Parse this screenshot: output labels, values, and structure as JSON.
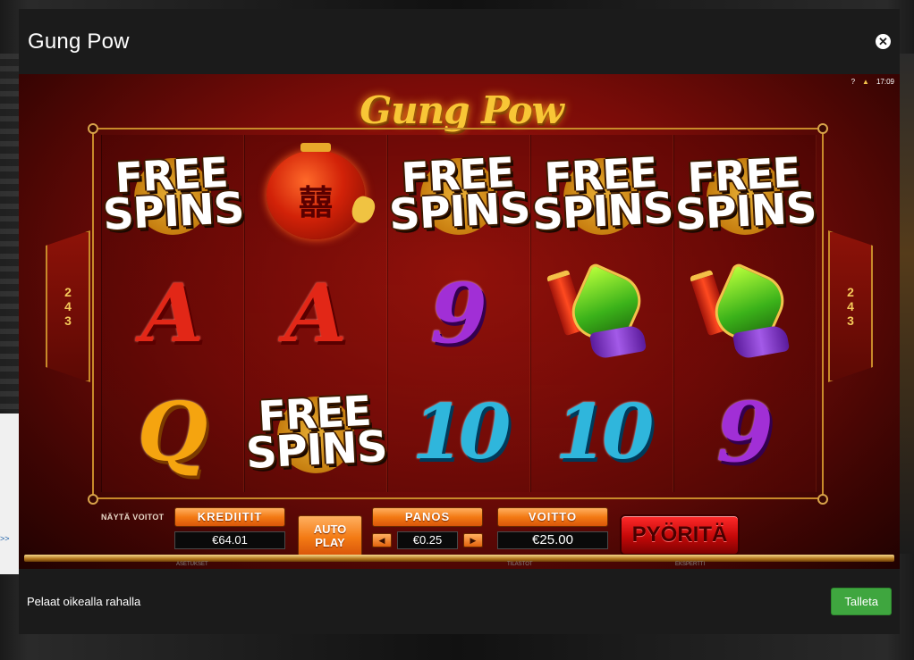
{
  "modal": {
    "title": "Gung Pow",
    "close_icon": "close-icon"
  },
  "game": {
    "logo": "Gung Pow",
    "clock": {
      "help": "?",
      "time": "17:09"
    },
    "ways_left": [
      "2",
      "4",
      "3"
    ],
    "ways_right": [
      "2",
      "4",
      "3"
    ],
    "reels": [
      [
        "free-spins",
        "letter-a",
        "letter-q"
      ],
      [
        "lantern",
        "letter-a",
        "free-spins"
      ],
      [
        "free-spins",
        "number-9",
        "number-10"
      ],
      [
        "free-spins",
        "rocket",
        "number-10"
      ],
      [
        "free-spins",
        "rocket",
        "number-9"
      ]
    ],
    "symbol_text": {
      "free_line1": "FREE",
      "free_line2": "SPINS",
      "a": "A",
      "q": "Q",
      "nine": "9",
      "ten": "10",
      "lantern_glyph": "囍"
    }
  },
  "controls": {
    "show_wins": "NÄYTÄ VOITOT",
    "credits_label": "KREDIITIT",
    "credits_value": "€64.01",
    "autoplay_line1": "AUTO",
    "autoplay_line2": "PLAY",
    "bet_label": "PANOS",
    "bet_value": "€0.25",
    "bet_decrease": "◀",
    "bet_increase": "▶",
    "win_label": "VOITTO",
    "win_value": "€25.00",
    "spin_label": "PYÖRITÄ"
  },
  "footer_links": {
    "settings": "ASETUKSET",
    "stats": "TILASTOT",
    "expert": "EKSPERTTI"
  },
  "modal_footer": {
    "text": "Pelaat oikealla rahalla",
    "deposit_button": "Talleta"
  },
  "backdrop": {
    "left_link": ">>"
  },
  "colors": {
    "modal_bg": "#1b1b1b",
    "deposit_green": "#3fa63f",
    "control_orange": "#f37a14",
    "spin_red": "#c40808"
  }
}
